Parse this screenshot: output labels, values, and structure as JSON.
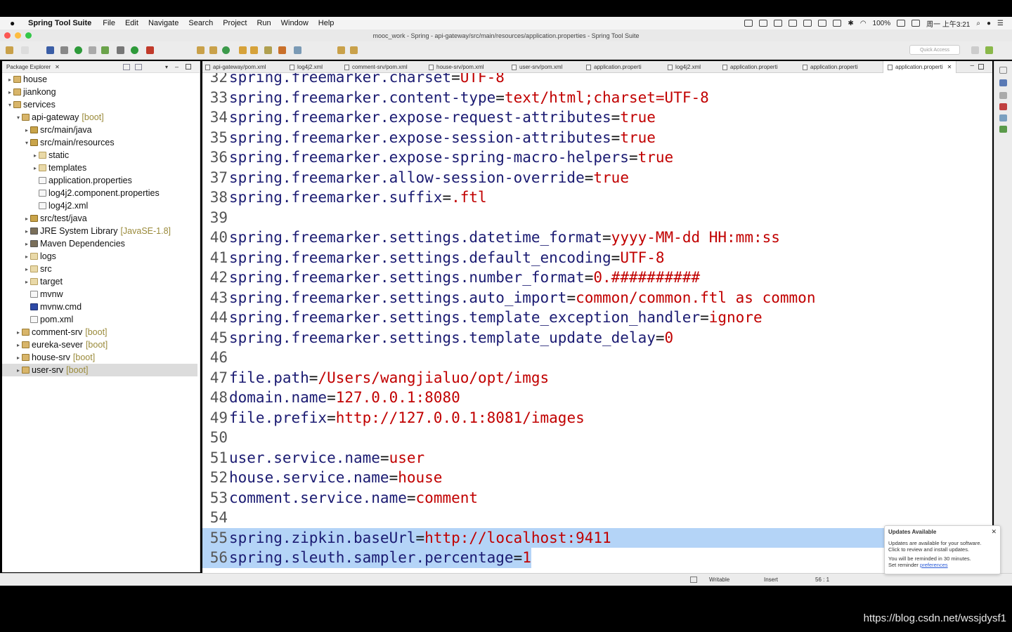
{
  "menubar": {
    "app": "Spring Tool Suite",
    "menus": [
      "File",
      "Edit",
      "Navigate",
      "Search",
      "Project",
      "Run",
      "Window",
      "Help"
    ],
    "battery": "100%",
    "clock": "周一 上午3:21"
  },
  "window": {
    "title": "mooc_work - Spring - api-gateway/src/main/resources/application.properties - Spring Tool Suite"
  },
  "toolbar": {
    "quick_access": "Quick Access"
  },
  "explorer": {
    "title": "Package Explorer",
    "nodes": [
      {
        "label": "house",
        "tag": ""
      },
      {
        "label": "jiankong",
        "tag": ""
      },
      {
        "label": "services",
        "tag": ""
      },
      {
        "label": "api-gateway",
        "tag": "[boot]"
      },
      {
        "label": "src/main/java",
        "tag": ""
      },
      {
        "label": "src/main/resources",
        "tag": ""
      },
      {
        "label": "static",
        "tag": ""
      },
      {
        "label": "templates",
        "tag": ""
      },
      {
        "label": "application.properties",
        "tag": ""
      },
      {
        "label": "log4j2.component.properties",
        "tag": ""
      },
      {
        "label": "log4j2.xml",
        "tag": ""
      },
      {
        "label": "src/test/java",
        "tag": ""
      },
      {
        "label": "JRE System Library",
        "tag": "[JavaSE-1.8]"
      },
      {
        "label": "Maven Dependencies",
        "tag": ""
      },
      {
        "label": "logs",
        "tag": ""
      },
      {
        "label": "src",
        "tag": ""
      },
      {
        "label": "target",
        "tag": ""
      },
      {
        "label": "mvnw",
        "tag": ""
      },
      {
        "label": "mvnw.cmd",
        "tag": ""
      },
      {
        "label": "pom.xml",
        "tag": ""
      },
      {
        "label": "comment-srv",
        "tag": "[boot]"
      },
      {
        "label": "eureka-sever",
        "tag": "[boot]"
      },
      {
        "label": "house-srv",
        "tag": "[boot]"
      },
      {
        "label": "user-srv",
        "tag": "[boot]"
      }
    ]
  },
  "tabs": [
    "api-gateway/pom.xml",
    "log4j2.xml",
    "comment-srv/pom.xml",
    "house-srv/pom.xml",
    "user-srv/pom.xml",
    "application.properti",
    "log4j2.xml",
    "application.properti",
    "application.properti",
    "application.properti"
  ],
  "editor": {
    "lines": [
      {
        "n": "32",
        "key": "spring.freemarker.charset",
        "val": "UTF-8"
      },
      {
        "n": "33",
        "key": "spring.freemarker.content-type",
        "val": "text/html;charset=UTF-8"
      },
      {
        "n": "34",
        "key": "spring.freemarker.expose-request-attributes",
        "val": "true"
      },
      {
        "n": "35",
        "key": "spring.freemarker.expose-session-attributes",
        "val": "true"
      },
      {
        "n": "36",
        "key": "spring.freemarker.expose-spring-macro-helpers",
        "val": "true"
      },
      {
        "n": "37",
        "key": "spring.freemarker.allow-session-override",
        "val": "true"
      },
      {
        "n": "38",
        "key": "spring.freemarker.suffix",
        "val": ".ftl"
      },
      {
        "n": "39",
        "key": "",
        "val": ""
      },
      {
        "n": "40",
        "key": "spring.freemarker.settings.datetime_format",
        "val": "yyyy-MM-dd HH:mm:ss"
      },
      {
        "n": "41",
        "key": "spring.freemarker.settings.default_encoding",
        "val": "UTF-8"
      },
      {
        "n": "42",
        "key": "spring.freemarker.settings.number_format",
        "val": "0.##########"
      },
      {
        "n": "43",
        "key": "spring.freemarker.settings.auto_import",
        "val": "common/common.ftl as common"
      },
      {
        "n": "44",
        "key": "spring.freemarker.settings.template_exception_handler",
        "val": "ignore"
      },
      {
        "n": "45",
        "key": "spring.freemarker.settings.template_update_delay",
        "val": "0"
      },
      {
        "n": "46",
        "key": "",
        "val": ""
      },
      {
        "n": "47",
        "key": "file.path",
        "val": "/Users/wangjialuo/opt/imgs"
      },
      {
        "n": "48",
        "key": "domain.name",
        "val": "127.0.0.1:8080"
      },
      {
        "n": "49",
        "key": "file.prefix",
        "val": "http://127.0.0.1:8081/images"
      },
      {
        "n": "50",
        "key": "",
        "val": ""
      },
      {
        "n": "51",
        "key": "user.service.name",
        "val": "user"
      },
      {
        "n": "52",
        "key": "house.service.name",
        "val": "house"
      },
      {
        "n": "53",
        "key": "comment.service.name",
        "val": "comment"
      },
      {
        "n": "54",
        "key": "",
        "val": ""
      },
      {
        "n": "55",
        "key": "spring.zipkin.baseUrl",
        "val": "http://localhost:9411"
      },
      {
        "n": "56",
        "key": "spring.sleuth.sampler.percentage",
        "val": "1"
      }
    ]
  },
  "statusbar": {
    "writable": "Writable",
    "insert": "Insert",
    "position": "56 : 1"
  },
  "popup": {
    "title": "Updates Available",
    "line1": "Updates are available for your software.",
    "line2": "Click to review and install updates.",
    "line3": "You will be reminded in 30 minutes.",
    "line4_prefix": "Set reminder ",
    "line4_link": "preferences"
  },
  "watermark": "https://blog.csdn.net/wssjdysf1"
}
